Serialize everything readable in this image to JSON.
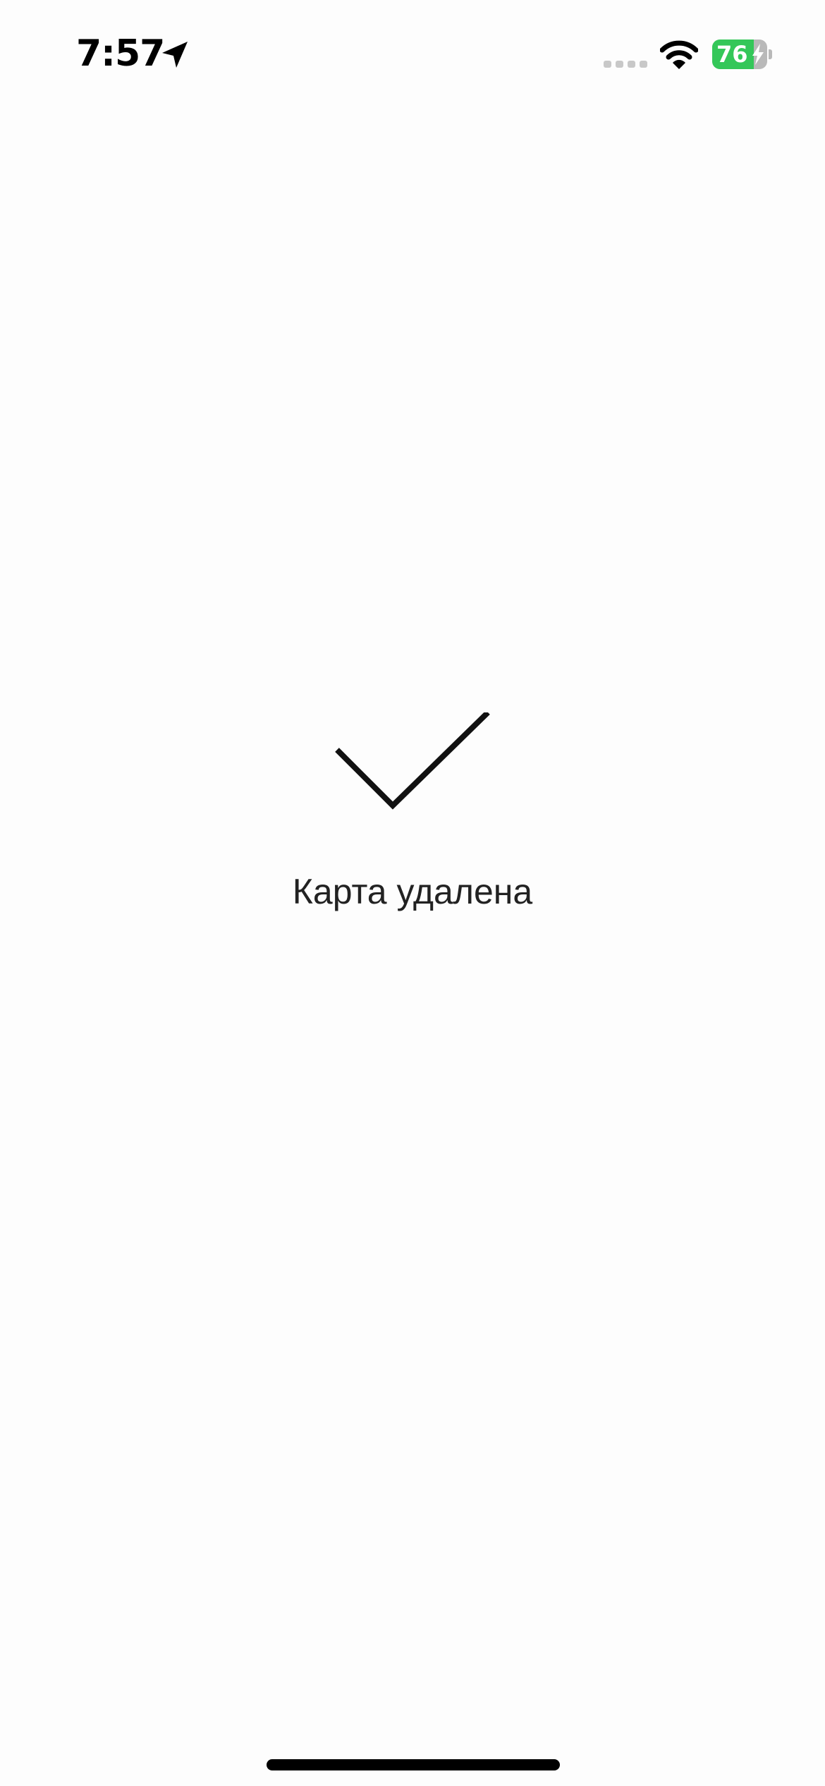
{
  "status_bar": {
    "time": "7:57",
    "battery_level": 76,
    "battery_label": "76",
    "charging": true,
    "icons": [
      "location-arrow-icon",
      "cellular-signal-icon",
      "wifi-icon",
      "battery-icon",
      "charging-bolt-icon"
    ]
  },
  "main": {
    "icon": "checkmark-icon",
    "message": "Карта удалена"
  },
  "colors": {
    "background": "#fdfdfd",
    "text": "#222222",
    "battery_green": "#34c759",
    "battery_empty": "#b9b9b9",
    "signal_inactive": "#c8c8c8"
  }
}
